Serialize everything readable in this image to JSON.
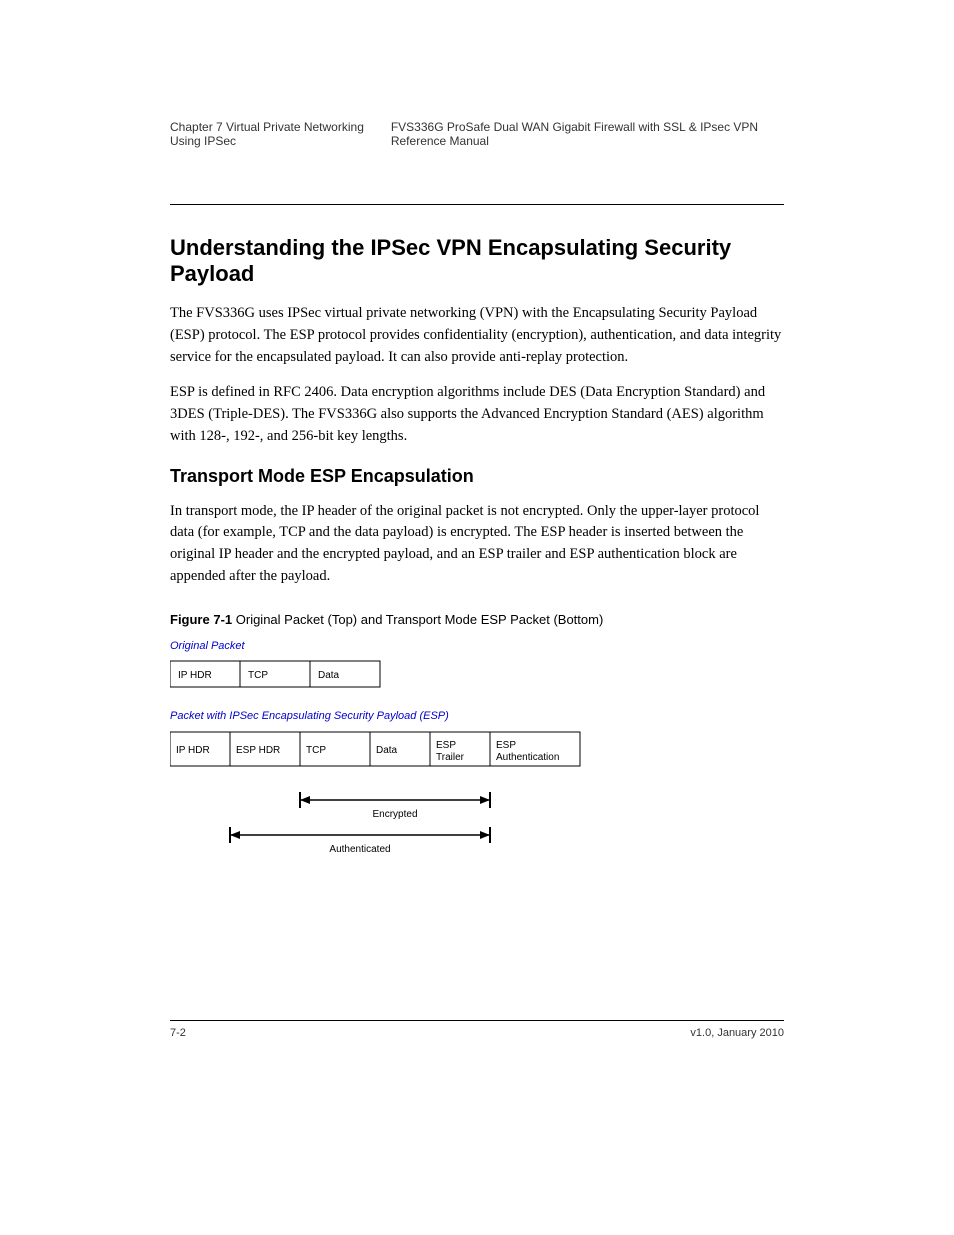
{
  "header": {
    "left": "Chapter 7 Virtual Private Networking Using IPSec",
    "right": "FVS336G ProSafe Dual WAN Gigabit Firewall with SSL & IPsec VPN Reference Manual"
  },
  "chapter_title": "",
  "section_title": "Understanding the IPSec VPN Encapsulating Security Payload",
  "para1": "The FVS336G uses IPSec virtual private networking (VPN) with the Encapsulating Security Payload (ESP) protocol. The ESP protocol provides confidentiality (encryption), authentication, and data integrity service for the encapsulated payload. It can also provide anti-replay protection.",
  "para2": "ESP is defined in RFC 2406. Data encryption algorithms include DES (Data Encryption Standard) and 3DES (Triple-DES). The FVS336G also supports the Advanced Encryption Standard (AES) algorithm with 128-, 192-, and 256-bit key lengths.",
  "sub_title": "Transport Mode ESP Encapsulation",
  "para3": "In transport mode, the IP header of the original packet is not encrypted. Only the upper-layer protocol data (for example, TCP and the data payload) is encrypted. The ESP header is inserted between the original IP header and the encrypted payload, and an ESP trailer and ESP authentication block are appended after the payload.",
  "figure": {
    "number": "Figure 7-1",
    "title": "Original Packet (Top) and Transport Mode ESP Packet (Bottom)"
  },
  "diagram": {
    "caption_top": "Original Packet",
    "orig": [
      "IP HDR",
      "TCP",
      "Data"
    ],
    "caption_mid": "Packet with IPSec Encapsulating Security Payload (ESP)",
    "esp": [
      "IP HDR",
      "ESP HDR",
      "TCP",
      "Data",
      "ESP Trailer",
      "ESP Authentication"
    ],
    "arrow1": "Encrypted",
    "arrow2": "Authenticated"
  },
  "footer": {
    "left": "7-2",
    "right": "v1.0, January 2010"
  }
}
